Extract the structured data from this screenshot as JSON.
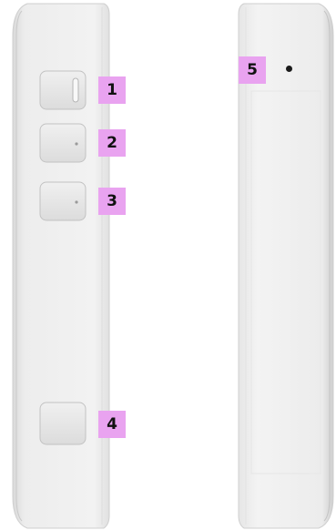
{
  "device": {
    "left_view": {
      "callouts": [
        {
          "label": "1"
        },
        {
          "label": "2"
        },
        {
          "label": "3"
        },
        {
          "label": "4"
        }
      ]
    },
    "right_view": {
      "callouts": [
        {
          "label": "5"
        }
      ]
    }
  },
  "colors": {
    "callout_bg": "#e9a3f0",
    "device_body": "#ededed",
    "device_edge": "#d4d4d4",
    "button_face": "#e6e6e6"
  },
  "icons": {
    "button_1": "slide-switch-icon",
    "button_2": "side-button-icon",
    "button_3": "side-button-icon",
    "button_4": "plain-button-icon",
    "hole_5": "pinhole-icon"
  }
}
